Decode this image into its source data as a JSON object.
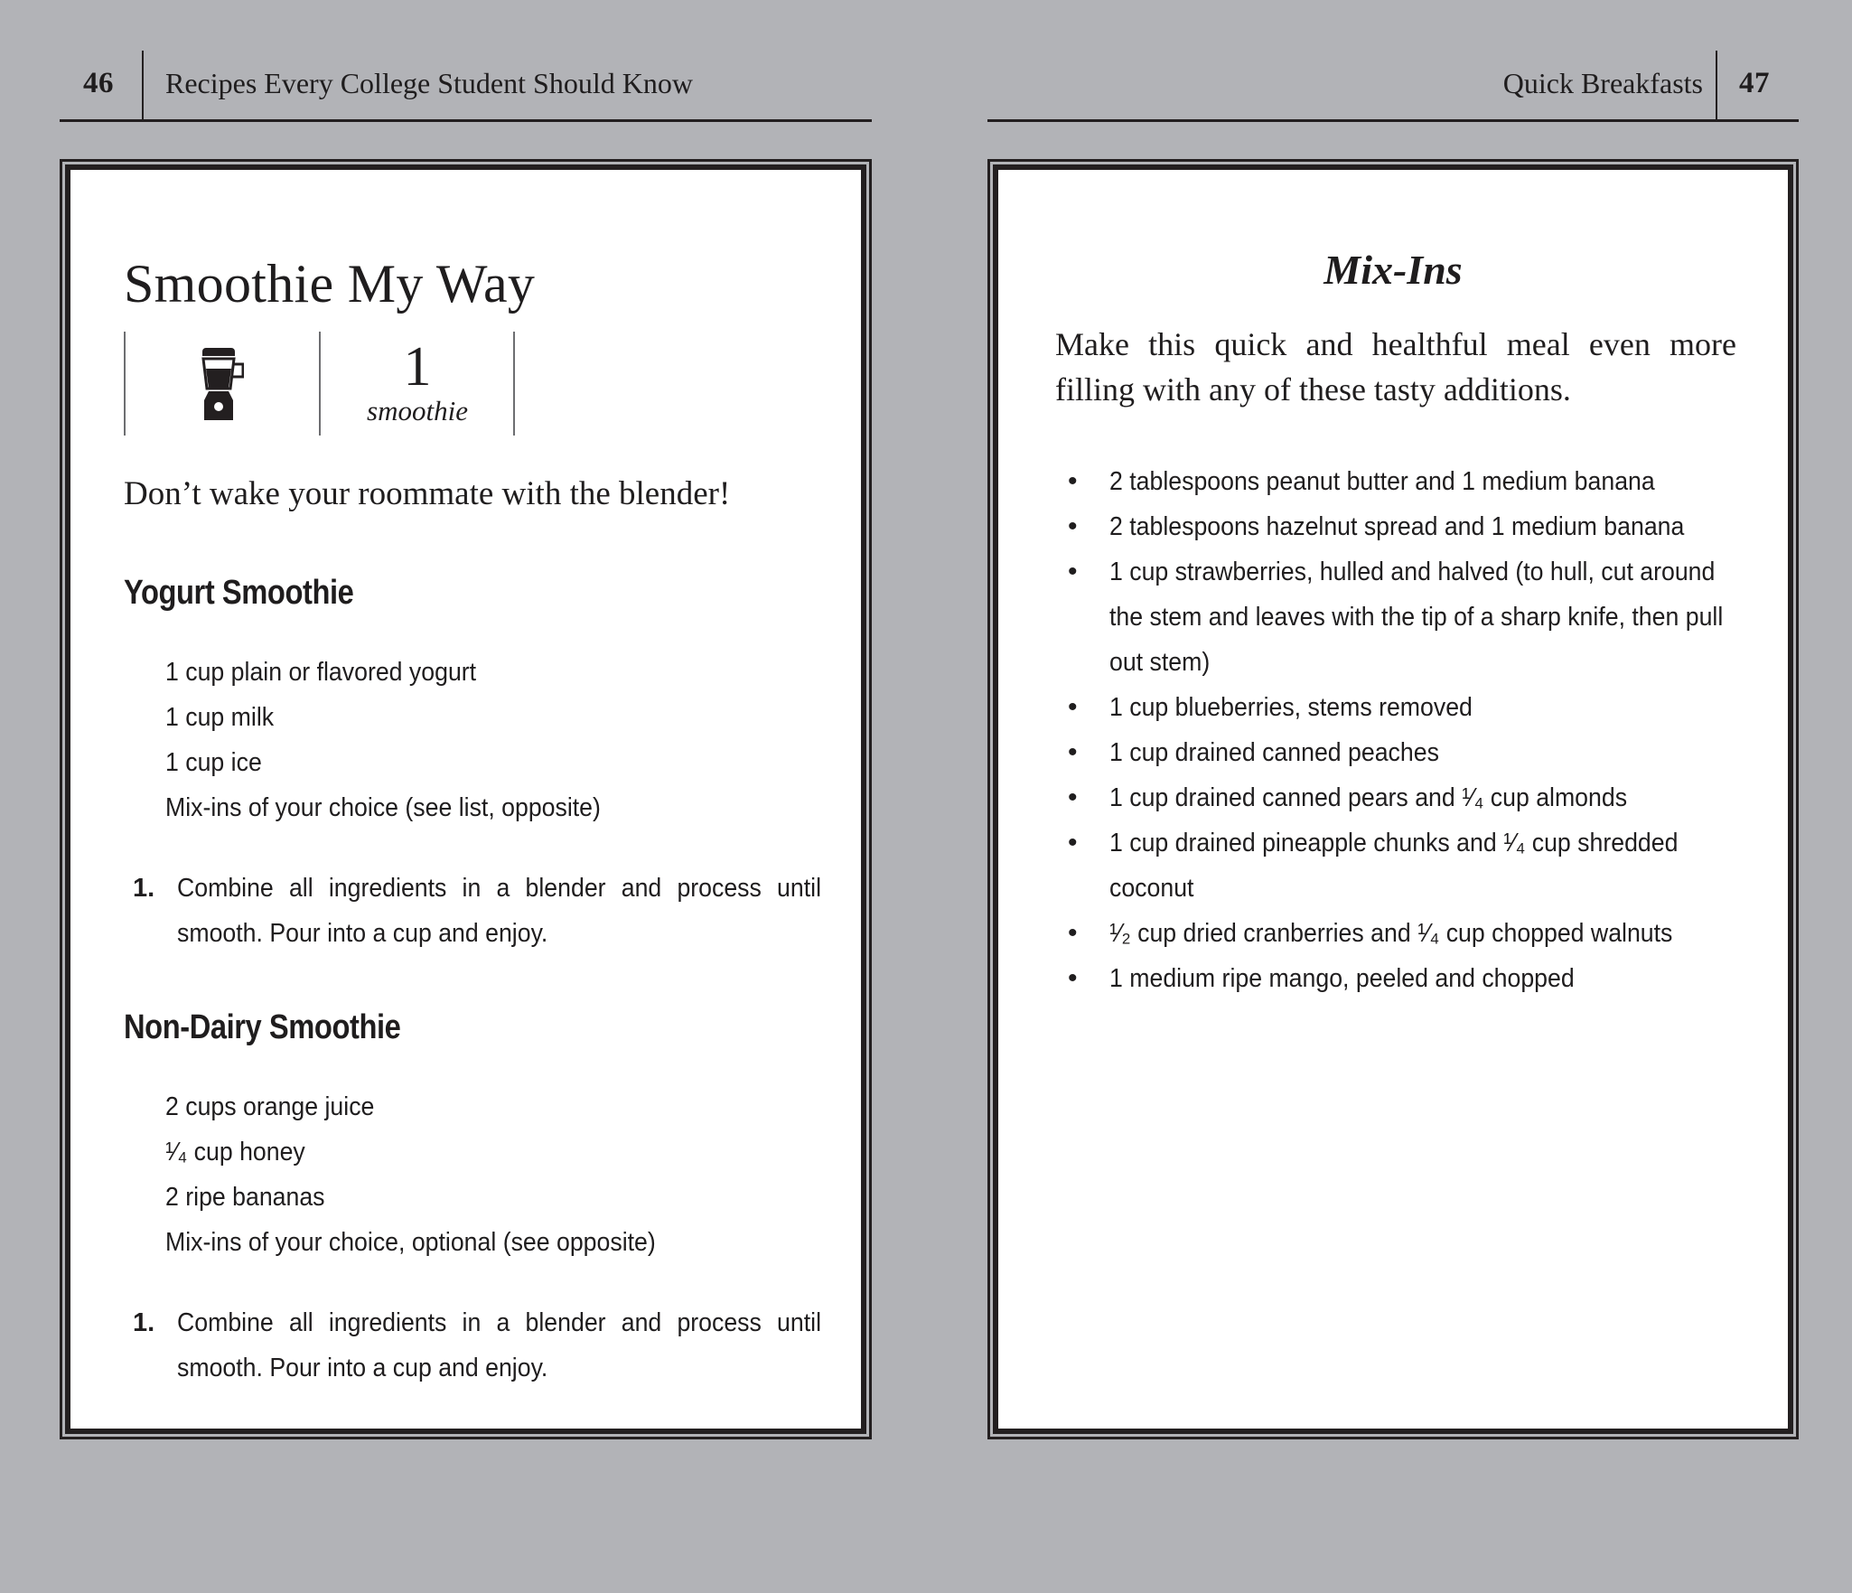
{
  "spread": {
    "left_page": {
      "page_number": "46",
      "running_title": "Recipes Every College Student Should Know",
      "recipe": {
        "title": "Smoothie My Way",
        "equipment_icon": "blender-icon",
        "yield": {
          "quantity": "1",
          "unit": "smoothie"
        },
        "tagline": "Don’t wake your roommate with the blender!",
        "variations": [
          {
            "heading": "Yogurt Smoothie",
            "ingredients": [
              "1 cup plain or flavored yogurt",
              "1 cup milk",
              "1 cup ice",
              "Mix-ins of your choice (see list, opposite)"
            ],
            "steps": [
              {
                "number": "1.",
                "text": "Combine all ingredients in a blender and process until smooth. Pour into a cup and enjoy."
              }
            ]
          },
          {
            "heading": "Non-Dairy Smoothie",
            "ingredients": [
              "2 cups orange juice",
              "¹⁄₄ cup honey",
              "2 ripe bananas",
              "Mix-ins of your choice, optional (see opposite)"
            ],
            "steps": [
              {
                "number": "1.",
                "text": "Combine all ingredients in a blender and process until smooth. Pour into a cup and enjoy."
              }
            ]
          }
        ]
      }
    },
    "right_page": {
      "page_number": "47",
      "running_title": "Quick Breakfasts",
      "sidebar": {
        "title": "Mix-Ins",
        "intro": "Make this quick and healthful meal even more filling with any of these tasty additions.",
        "items": [
          "2 tablespoons peanut butter and 1 medium banana",
          "2 tablespoons hazelnut spread and 1 medium banana",
          "1 cup strawberries, hulled and halved (to hull, cut around the stem and leaves with the tip of a sharp knife, then pull out stem)",
          "1 cup blueberries, stems removed",
          "1 cup drained canned peaches",
          "1 cup drained canned pears and ¹⁄₄ cup almonds",
          "1 cup drained pineapple chunks and ¹⁄₄ cup shredded coconut",
          "¹⁄₂ cup dried cranberries and ¹⁄₄ cup chopped walnuts",
          "1 medium ripe mango, peeled and chopped"
        ],
        "bullet_glyph": "•"
      }
    },
    "colors": {
      "background": "#b2b3b7",
      "ink": "#231f20",
      "page": "#ffffff",
      "divider": "#6d6e71"
    }
  }
}
